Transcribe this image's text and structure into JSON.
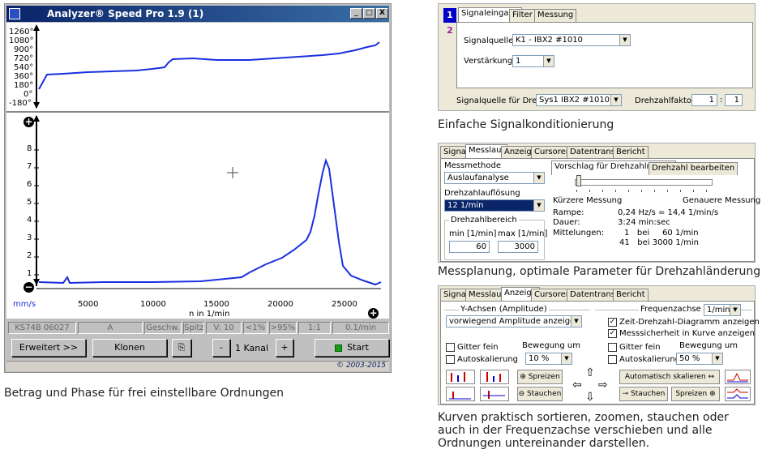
{
  "window": {
    "title": "Analyzer® Speed Pro 1.9 (1)",
    "title_btns": [
      "_",
      "□",
      "X"
    ],
    "phase_ticks": [
      "1260°",
      "1080°",
      "900°",
      "720°",
      "540°",
      "360°",
      "180°",
      "0°",
      "-180°"
    ],
    "amp_ticks": [
      "8",
      "7",
      "6",
      "5",
      "4",
      "3",
      "2",
      "1"
    ],
    "x_ticks": [
      "5000",
      "10000",
      "15000",
      "20000",
      "25000"
    ],
    "x_unit": "mm/s",
    "x_label": "n in 1/min",
    "status": [
      "KS74B 06027",
      "A",
      "Geschw.",
      "Spitz",
      "V: 10",
      "<1%",
      ">95%",
      "1:1",
      "0.1/min"
    ],
    "btn_erweitert": "Erweitert >>",
    "btn_klonen": "Klonen",
    "btn_minus": "-",
    "kanal": "1 Kanal",
    "btn_plus": "+",
    "btn_start": "Start",
    "copyright": "© 2003-2015"
  },
  "caption_left": "Betrag und Phase für frei einstellbare Ordnungen",
  "panel1": {
    "ch1": "1",
    "ch2": "2",
    "tabs": [
      "Signaleingang",
      "Filter",
      "Messung"
    ],
    "signalquelle_label": "Signalquelle",
    "signalquelle_value": "K1 - IBX2 #1010",
    "verstaerkung_label": "Verstärkung",
    "verstaerkung_value": "1",
    "drehzahl_label": "Signalquelle für Drehzahl",
    "drehzahl_value": "Sys1 IBX2 #1010",
    "faktor_label": "Drehzahlfaktor",
    "faktor_a": "1",
    "faktor_b": "1",
    "caption": "Einfache Signalkonditionierung"
  },
  "panel2": {
    "tabs": [
      "Signal",
      "Messlauf",
      "Anzeige",
      "Cursoren",
      "Datentransfer",
      "Bericht"
    ],
    "messmethode_label": "Messmethode",
    "messmethode_value": "Auslaufanalyse",
    "aufloesung_label": "Drehzahlauflösung",
    "aufloesung_value": "12 1/min",
    "bereich_label": "Drehzahlbereich",
    "min_label": "min [1/min]",
    "max_label": "max [1/min]",
    "min_value": "60",
    "max_value": "3000",
    "subtabs": [
      "Vorschlag für Drehzahlrampe",
      "Drehzahl bearbeiten"
    ],
    "kuerzer": "Kürzere Messung",
    "genauer": "Genauere Messung",
    "rampe_label": "Rampe:",
    "rampe_value": "0,24 Hz/s  =  14,4 1/min/s",
    "dauer_label": "Dauer:",
    "dauer_value": "3:24 min:sec",
    "mitt_label": "Mittelungen:",
    "mitt_value1": "1   bei     60 1/min",
    "mitt_value2": "41   bei 3000 1/min",
    "caption": "Messplanung, optimale Parameter für Drehzahländerung"
  },
  "panel3": {
    "tabs": [
      "Signal",
      "Messlauf",
      "Anzeige",
      "Cursoren",
      "Datentransfer",
      "Bericht"
    ],
    "yachsen_label": "Y-Achsen (Amplitude)",
    "yachsen_value": "vorwiegend Amplitude anzeigen",
    "frequenz_label": "Frequenzachse",
    "frequenz_value": "1/min",
    "zeit_drehzahl": "Zeit-Drehzahl-Diagramm anzeigen",
    "messsicherheit": "Messsicherheit in Kurve anzeigen",
    "gitter_left": "Gitter fein",
    "auto_left": "Autoskalierung",
    "bewegung_left_label": "Bewegung um",
    "bewegung_left_value": "10 %",
    "gitter_right": "Gitter fein",
    "auto_right": "Autoskalierung",
    "bewegung_right_label": "Bewegung um",
    "bewegung_right_value": "50 %",
    "spreizen": "Spreizen",
    "stauchen": "Stauchen",
    "auto_skalieren": "Automatisch skalieren",
    "stauchen2": "Stauchen",
    "spreizen2": "Spreizen",
    "caption": "Kurven praktisch sortieren, zoomen, stauchen oder auch in der Frequenzachse verschieben und alle Ordnungen untereinander darstellen."
  }
}
